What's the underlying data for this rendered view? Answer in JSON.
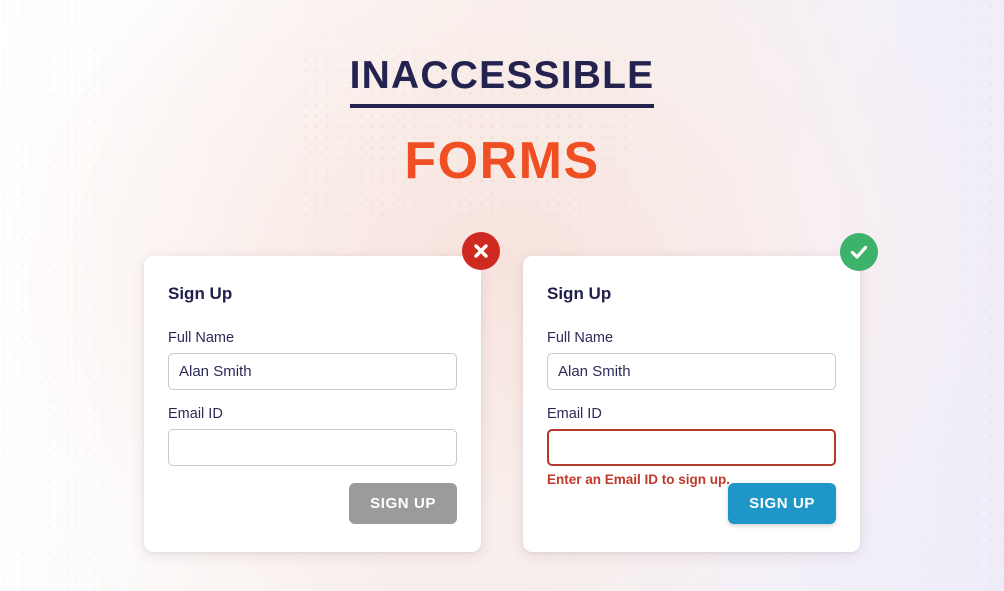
{
  "heading": {
    "title": "INACCESSIBLE",
    "subtitle": "FORMS",
    "title_color": "#24234f",
    "subtitle_color": "#f04e23"
  },
  "cards": {
    "inaccessible": {
      "title": "Sign Up",
      "status_icon": "error-circle-x-icon",
      "status_color": "#cf2a21",
      "fields": [
        {
          "label": "Full Name",
          "value": "Alan Smith",
          "placeholder": "",
          "error": ""
        },
        {
          "label": "Email ID",
          "value": "",
          "placeholder": "",
          "error": ""
        }
      ],
      "button": {
        "label": "SIGN UP",
        "color": "#9b9b9b",
        "state": "disabled"
      }
    },
    "accessible": {
      "title": "Sign Up",
      "status_icon": "success-circle-check-icon",
      "status_color": "#3cb26a",
      "fields": [
        {
          "label": "Full Name",
          "value": "Alan Smith",
          "placeholder": "",
          "error": ""
        },
        {
          "label": "Email ID",
          "value": "",
          "placeholder": "",
          "error": "Enter an Email ID to sign up."
        }
      ],
      "button": {
        "label": "SIGN UP",
        "color": "#1e96c8",
        "state": "enabled"
      }
    }
  }
}
